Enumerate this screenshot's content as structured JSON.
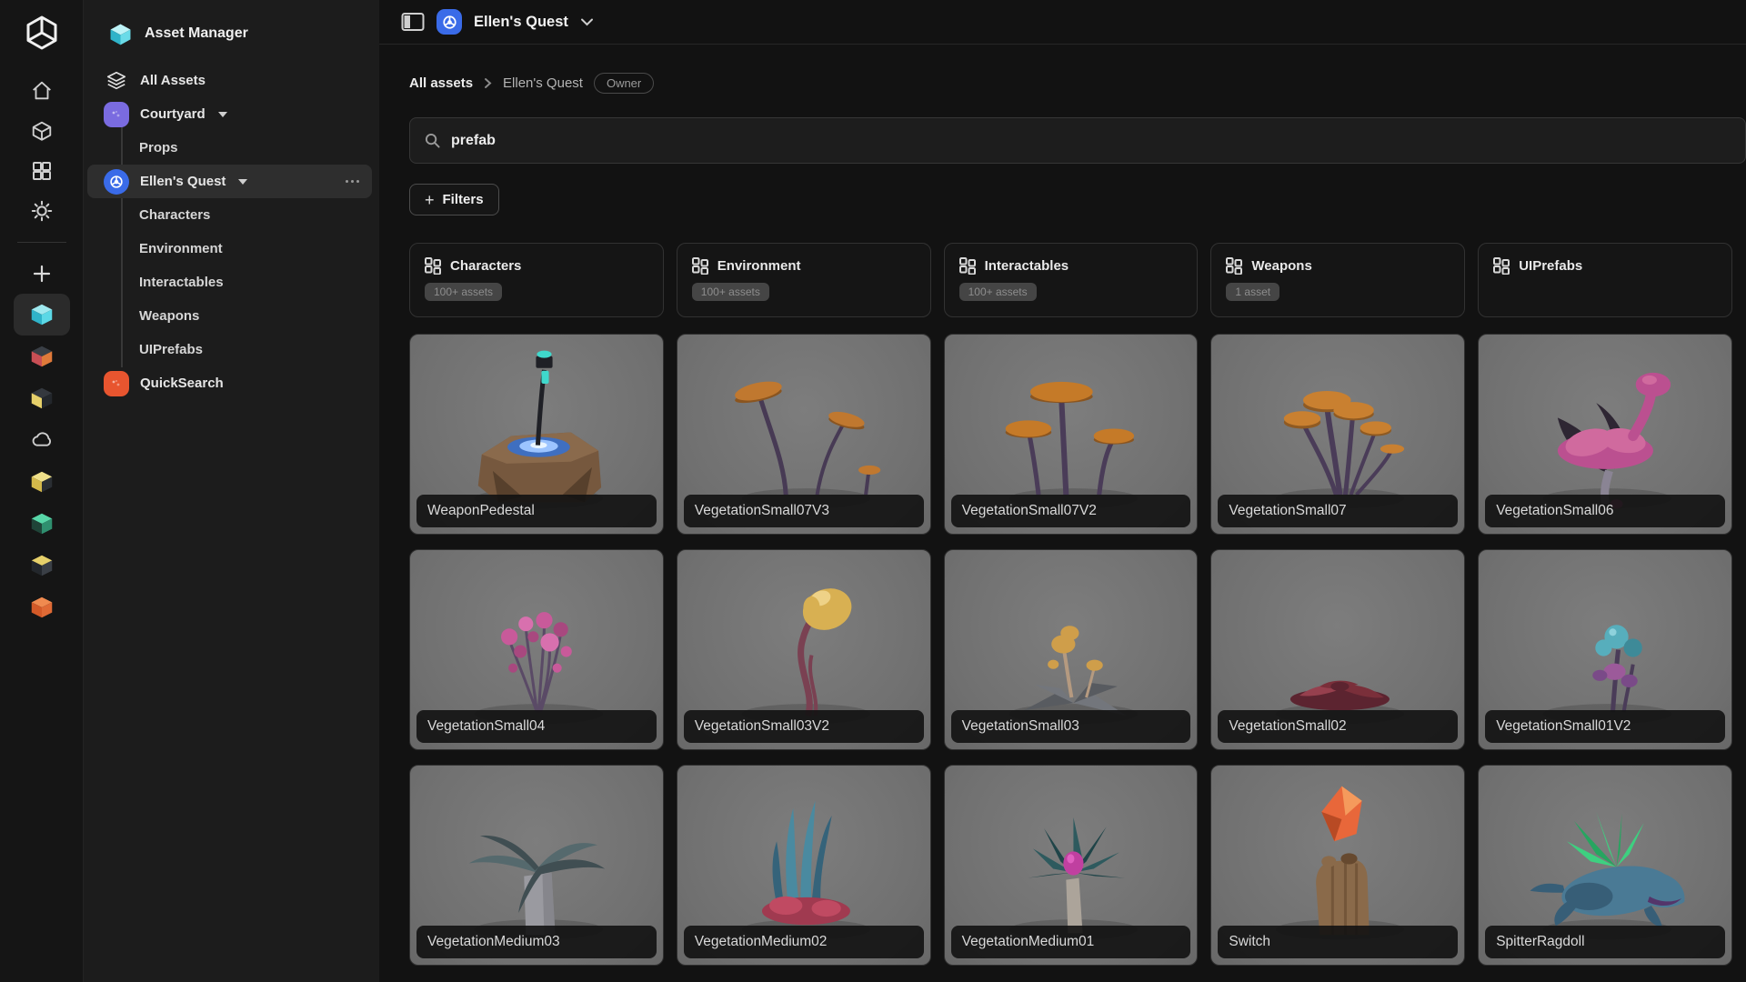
{
  "sidebar": {
    "title": "Asset Manager",
    "items": [
      {
        "type": "link",
        "icon": "layers-icon",
        "label": "All Assets"
      },
      {
        "type": "project",
        "label": "Courtyard",
        "color": "#7a6be0",
        "shape": "square",
        "chevron": true
      },
      {
        "type": "child",
        "label": "Props"
      },
      {
        "type": "project",
        "label": "Ellen's Quest",
        "color": "#3a6be8",
        "shape": "circle",
        "chevron": true,
        "selected": true,
        "more": true,
        "glyph": "wheel"
      },
      {
        "type": "child",
        "label": "Characters"
      },
      {
        "type": "child",
        "label": "Environment"
      },
      {
        "type": "child",
        "label": "Interactables"
      },
      {
        "type": "child",
        "label": "Weapons"
      },
      {
        "type": "child",
        "label": "UIPrefabs"
      },
      {
        "type": "project",
        "label": "QuickSearch",
        "color": "#e8552f",
        "shape": "square",
        "chevron": false
      }
    ]
  },
  "rail": {
    "projects": [
      {
        "kind": "cube",
        "active": true,
        "top": "#9fe9ef",
        "left": "#2fb3c9",
        "right": "#5bd8e6"
      },
      {
        "kind": "cube",
        "active": false,
        "top": "#3a3f46",
        "left": "#c94f55",
        "right": "#e07a3a"
      },
      {
        "kind": "cube",
        "active": false,
        "top": "#34383e",
        "left": "#e6d06a",
        "right": "#23272c"
      },
      {
        "kind": "cloud",
        "active": false,
        "top": "#cfcfcf",
        "left": "#cfcfcf",
        "right": "#cfcfcf"
      },
      {
        "kind": "cube",
        "active": false,
        "top": "#efe08a",
        "left": "#d4b94a",
        "right": "#2a2e33"
      },
      {
        "kind": "cube",
        "active": false,
        "top": "#58d6a8",
        "left": "#1f4438",
        "right": "#2f8f6f"
      },
      {
        "kind": "cube",
        "active": false,
        "top": "#e6d06a",
        "left": "#23272c",
        "right": "#3a3f46"
      },
      {
        "kind": "cube",
        "active": false,
        "top": "#f08a4f",
        "left": "#d45a28",
        "right": "#e06a35"
      }
    ]
  },
  "topbar": {
    "project": "Ellen's Quest"
  },
  "breadcrumb": {
    "root": "All assets",
    "current": "Ellen's Quest",
    "badge": "Owner"
  },
  "search": {
    "value": "prefab",
    "placeholder": ""
  },
  "filters": {
    "label": "Filters"
  },
  "collections": [
    {
      "label": "Characters",
      "count": "100+ assets"
    },
    {
      "label": "Environment",
      "count": "100+ assets"
    },
    {
      "label": "Interactables",
      "count": "100+ assets"
    },
    {
      "label": "Weapons",
      "count": "1 asset"
    },
    {
      "label": "UIPrefabs",
      "count": null
    }
  ],
  "assets": [
    {
      "name": "WeaponPedestal",
      "thumb": "pedestal",
      "palette": {
        "rock": "#76583e",
        "rockDark": "#57402c",
        "rockLite": "#8a6a4c",
        "glow": "#3f6fc0",
        "glowLite": "#9cc4ff",
        "staff": "#1f2026",
        "gem": "#3fd8cc"
      }
    },
    {
      "name": "VegetationSmall07V3",
      "thumb": "mushrooms-sparse",
      "palette": {
        "stem": "#473a54",
        "cap": "#c0782f",
        "capDark": "#8a5520"
      }
    },
    {
      "name": "VegetationSmall07V2",
      "thumb": "mushrooms-three",
      "palette": {
        "stem": "#4a3c58",
        "cap": "#c57a28",
        "capDark": "#8a5520"
      }
    },
    {
      "name": "VegetationSmall07",
      "thumb": "mushrooms-cluster",
      "palette": {
        "stem": "#4a3c58",
        "cap": "#c98030",
        "capDark": "#8f5a22"
      }
    },
    {
      "name": "VegetationSmall06",
      "thumb": "flower-pink",
      "palette": {
        "petal": "#bb5090",
        "petalLite": "#d06a9e",
        "leaf": "#2e2633",
        "stem": "#8a8494"
      }
    },
    {
      "name": "VegetationSmall04",
      "thumb": "bulb-bouquet",
      "palette": {
        "b1": "#c85a9a",
        "b2": "#a8487f",
        "b3": "#d870ae",
        "stem": "#5a4a66"
      }
    },
    {
      "name": "VegetationSmall03V2",
      "thumb": "stalk-bulb",
      "palette": {
        "stem": "#7a4152",
        "bulb": "#d8b052",
        "bulbLite": "#eed287"
      }
    },
    {
      "name": "VegetationSmall03",
      "thumb": "mushrooms-small",
      "palette": {
        "leaf": "#73767c",
        "leafDark": "#585b60",
        "stem": "#b59a80",
        "cap": "#cf9e4a"
      }
    },
    {
      "name": "VegetationSmall02",
      "thumb": "lowplant",
      "palette": {
        "a": "#7a2f3a",
        "b": "#5c2430",
        "c": "#96404e"
      }
    },
    {
      "name": "VegetationSmall01V2",
      "thumb": "teal-bulbs",
      "palette": {
        "teal": "#57aebc",
        "tealDark": "#3e8a98",
        "pink": "#9c5a9a",
        "purple": "#7a4a88",
        "stem": "#4a3c58"
      }
    },
    {
      "name": "VegetationMedium03",
      "thumb": "palm-stone",
      "palette": {
        "stone": "#9a9aa0",
        "stoneDark": "#76767c",
        "frond": "#55696d",
        "frondDark": "#404e52"
      }
    },
    {
      "name": "VegetationMedium02",
      "thumb": "spikes-red",
      "palette": {
        "base": "#a03a50",
        "baseLite": "#c04a62",
        "blade": "#4a8aa0",
        "bladeDark": "#35637a"
      }
    },
    {
      "name": "VegetationMedium01",
      "thumb": "spiky-bulb",
      "palette": {
        "trunk": "#aca49a",
        "leaf": "#2e5a5e",
        "leafDark": "#1f4448",
        "bulb": "#c040a0",
        "bulbLite": "#e060c0"
      }
    },
    {
      "name": "Switch",
      "thumb": "crystal-totem",
      "palette": {
        "totem": "#8a6a4a",
        "totemDark": "#66492f",
        "crystal": "#e8673a",
        "crystalLite": "#f59a5c",
        "crystalDark": "#b84a24"
      }
    },
    {
      "name": "SpitterRagdoll",
      "thumb": "creature",
      "palette": {
        "body": "#4a7a95",
        "bodyDark": "#375e77",
        "frill": "#3ed080",
        "frillDark": "#27a560",
        "mouth": "#54356a"
      }
    }
  ]
}
